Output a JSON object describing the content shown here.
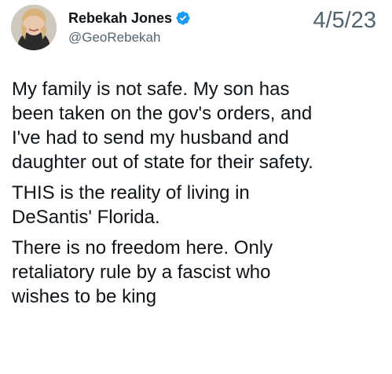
{
  "author": {
    "display_name": "Rebekah Jones",
    "handle": "@GeoRebekah",
    "verified": true,
    "verified_color": "#1d9bf0",
    "avatar_icon": "profile-photo"
  },
  "date": "4/5/23",
  "paragraphs": [
    {
      "lines": [
        "My family is not safe. My son has",
        "been taken on the gov's orders, and",
        "I've had to send my husband and",
        "daughter out of state for their safety."
      ]
    },
    {
      "lines": [
        "THIS is the reality of living in",
        "DeSantis' Florida."
      ]
    },
    {
      "lines": [
        "There is no freedom here.  Only",
        "retaliatory rule by a fascist who",
        "wishes to be king"
      ]
    }
  ]
}
